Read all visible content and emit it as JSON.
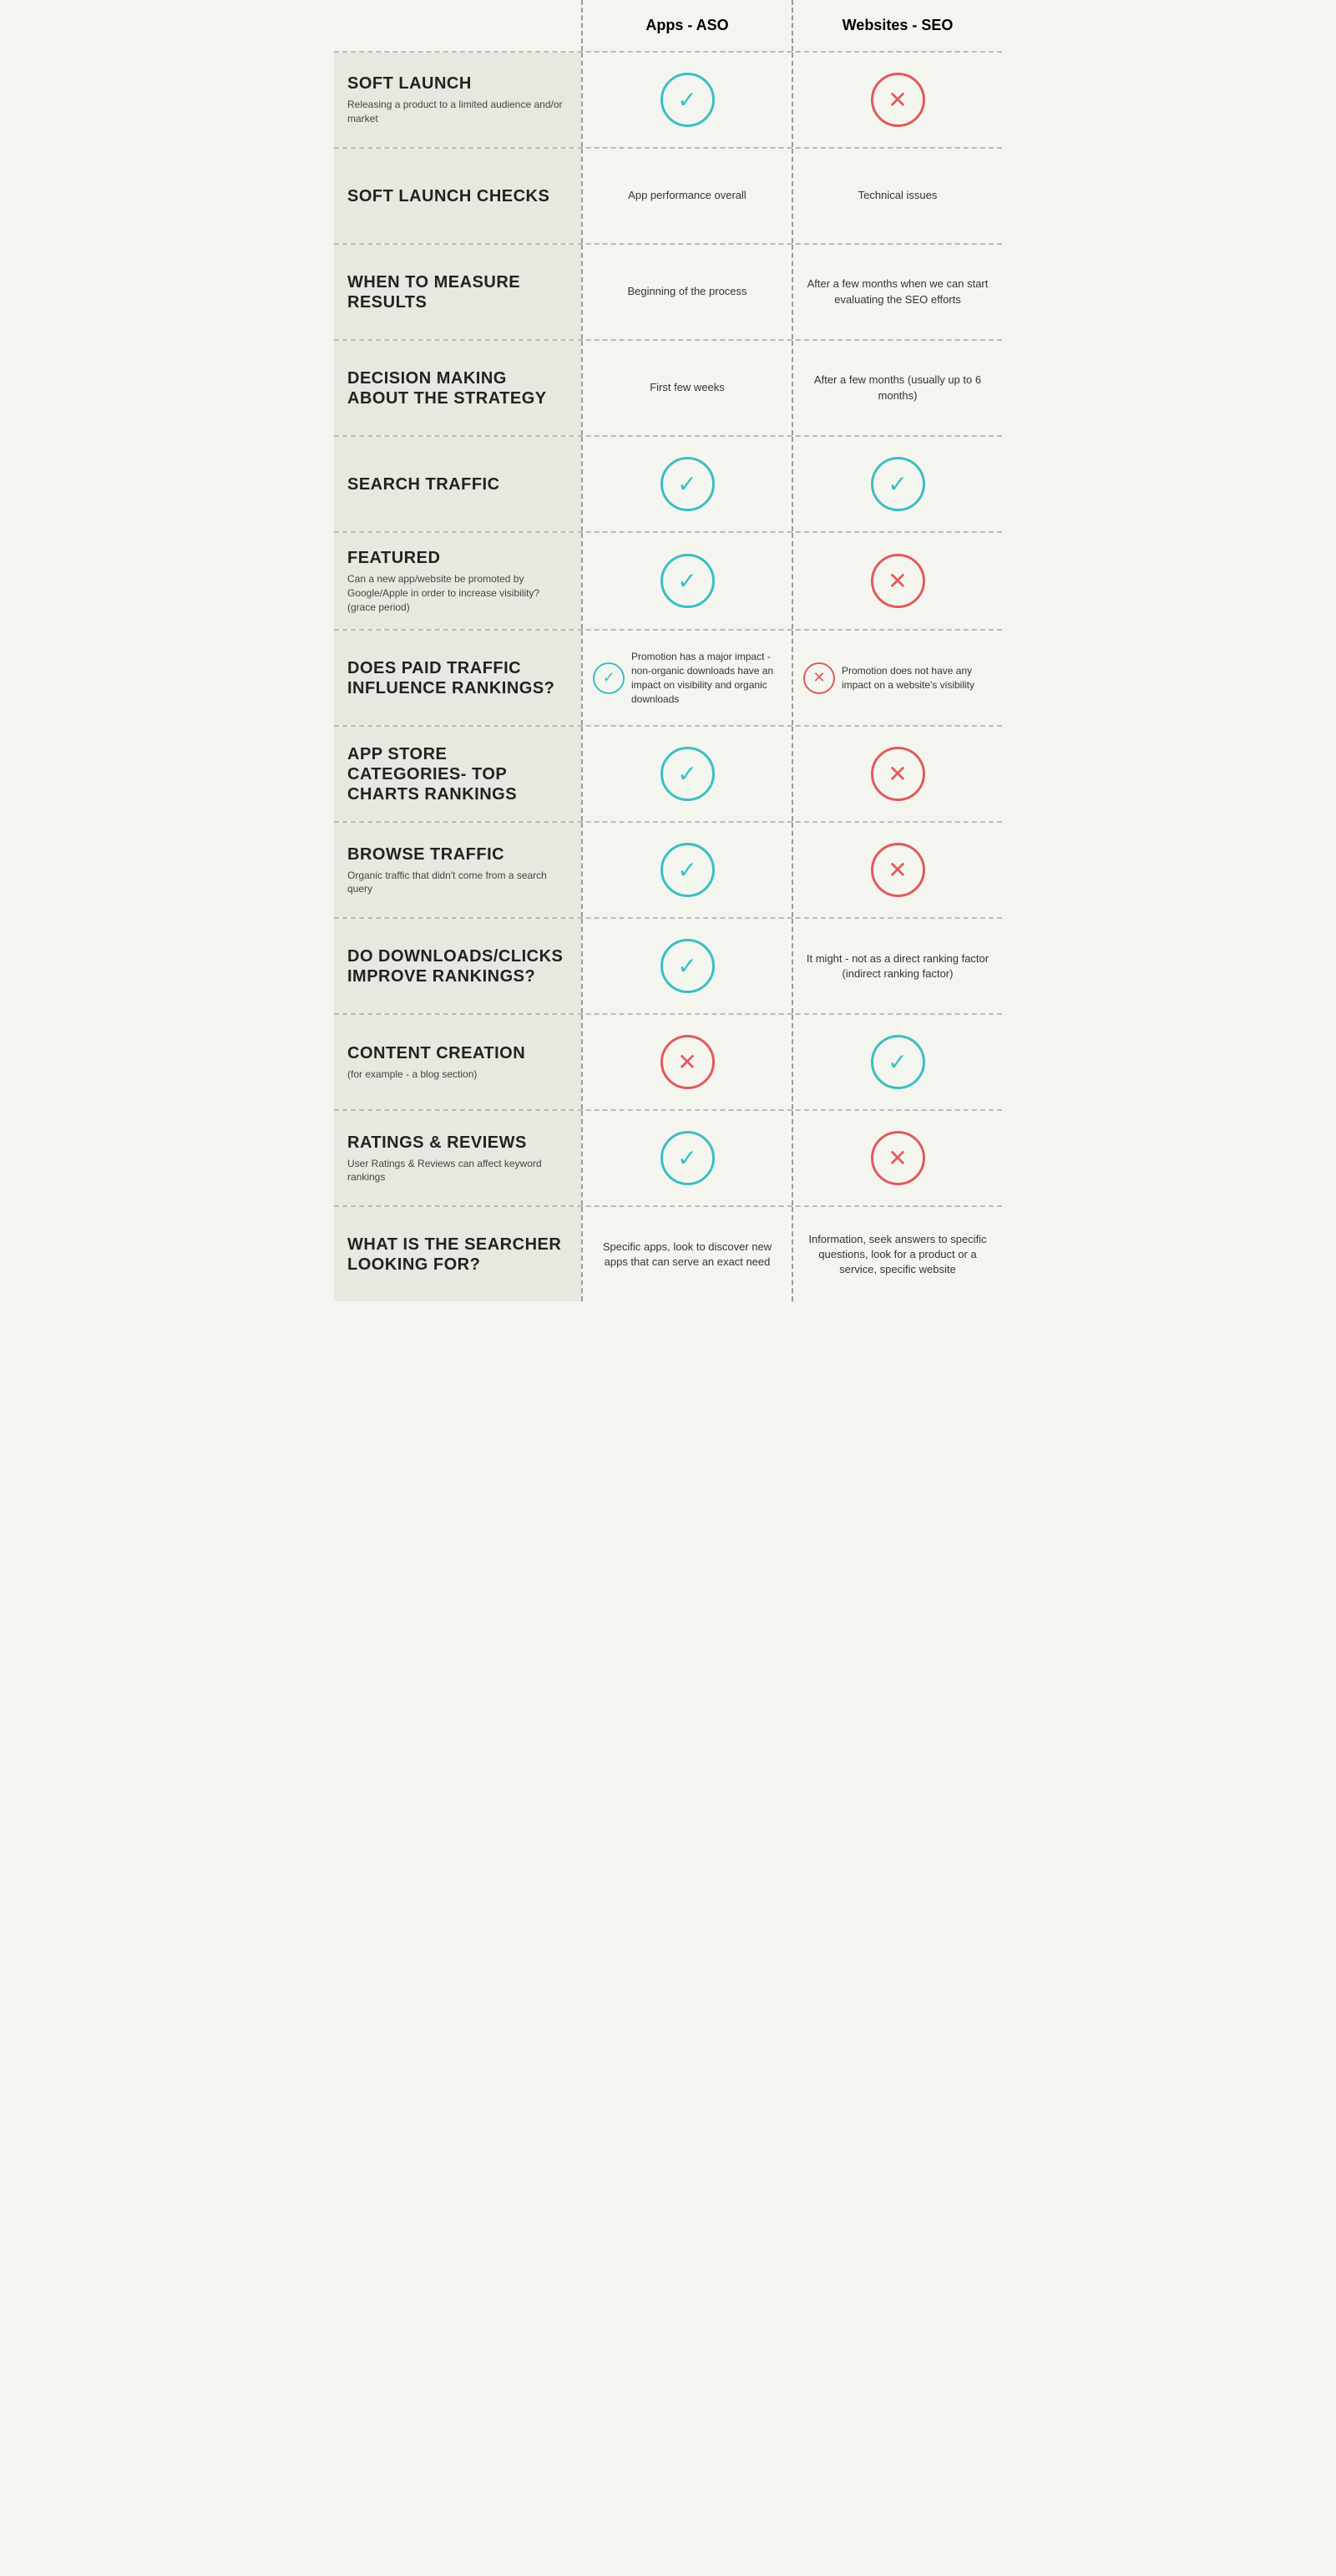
{
  "header": {
    "col1": "",
    "col2": "Apps - ASO",
    "col3": "Websites - SEO"
  },
  "rows": [
    {
      "id": "soft-launch",
      "title": "SOFT LAUNCH",
      "subtitle": "Releasing a product to a limited audience and/or market",
      "col2_type": "check",
      "col3_type": "cross",
      "col2_text": "",
      "col3_text": ""
    },
    {
      "id": "soft-launch-checks",
      "title": "SOFT LAUNCH CHECKS",
      "subtitle": "",
      "col2_type": "text",
      "col3_type": "text",
      "col2_text": "App performance overall",
      "col3_text": "Technical issues"
    },
    {
      "id": "when-to-measure",
      "title": "WHEN TO MEASURE RESULTS",
      "subtitle": "",
      "col2_type": "text",
      "col3_type": "text",
      "col2_text": "Beginning of the process",
      "col3_text": "After a few months when we can start evaluating the SEO efforts"
    },
    {
      "id": "decision-making",
      "title": "DECISION MAKING ABOUT THE STRATEGY",
      "subtitle": "",
      "col2_type": "text",
      "col3_type": "text",
      "col2_text": "First few weeks",
      "col3_text": "After a few months (usually up to 6 months)"
    },
    {
      "id": "search-traffic",
      "title": "SEARCH TRAFFIC",
      "subtitle": "",
      "col2_type": "check",
      "col3_type": "check",
      "col2_text": "",
      "col3_text": ""
    },
    {
      "id": "featured",
      "title": "FEATURED",
      "subtitle": "Can a new app/website be promoted by Google/Apple in order to increase visibility? (grace period)",
      "col2_type": "check",
      "col3_type": "cross",
      "col2_text": "",
      "col3_text": ""
    },
    {
      "id": "paid-traffic",
      "title": "DOES PAID TRAFFIC INFLUENCE RANKINGS?",
      "subtitle": "",
      "col2_type": "icon-text",
      "col3_type": "icon-text",
      "col2_icon": "check",
      "col3_icon": "cross",
      "col2_text": "Promotion has a major impact - non-organic downloads have an impact on visibility and organic downloads",
      "col3_text": "Promotion does not have any impact on a website's visibility"
    },
    {
      "id": "app-store-categories",
      "title": "APP STORE CATEGORIES- TOP CHARTS RANKINGS",
      "subtitle": "",
      "col2_type": "check",
      "col3_type": "cross",
      "col2_text": "",
      "col3_text": ""
    },
    {
      "id": "browse-traffic",
      "title": "BROWSE TRAFFIC",
      "subtitle": "Organic traffic that didn't come from a search query",
      "col2_type": "check",
      "col3_type": "cross",
      "col2_text": "",
      "col3_text": ""
    },
    {
      "id": "downloads-clicks",
      "title": "DO DOWNLOADS/CLICKS IMPROVE RANKINGS?",
      "subtitle": "",
      "col2_type": "check",
      "col3_type": "text",
      "col2_text": "",
      "col3_text": "It might - not as a direct ranking factor (indirect ranking factor)"
    },
    {
      "id": "content-creation",
      "title": "CONTENT CREATION",
      "subtitle": "(for example - a blog section)",
      "col2_type": "cross",
      "col3_type": "check",
      "col2_text": "",
      "col3_text": ""
    },
    {
      "id": "ratings-reviews",
      "title": "RATINGS & REVIEWS",
      "subtitle": "User Ratings & Reviews can affect keyword rankings",
      "col2_type": "check",
      "col3_type": "cross",
      "col2_text": "",
      "col3_text": ""
    },
    {
      "id": "searcher-looking",
      "title": "WHAT IS THE SEARCHER LOOKING FOR?",
      "subtitle": "",
      "col2_type": "text",
      "col3_type": "text",
      "col2_text": "Specific apps, look to discover new apps that can serve an exact need",
      "col3_text": "Information, seek answers to specific questions, look for a product or a service, specific website"
    }
  ]
}
